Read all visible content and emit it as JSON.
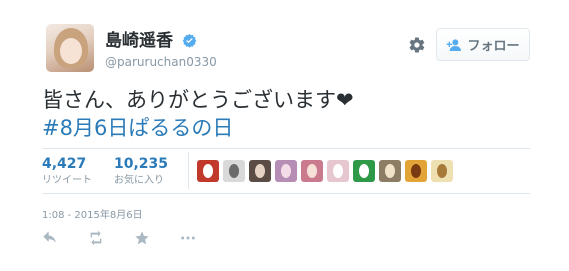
{
  "user": {
    "display_name": "島崎遥香",
    "handle": "@paruruchan0330",
    "verified": true
  },
  "follow_button": {
    "label": "フォロー"
  },
  "tweet": {
    "line1": "皆さん、ありがとうございます",
    "line1_emoji": "❤",
    "line2": "#8月6日ぱるるの日"
  },
  "stats": {
    "retweets": {
      "count": "4,427",
      "label": "リツイート"
    },
    "favorites": {
      "count": "10,235",
      "label": "お気に入り"
    }
  },
  "favoriters_avatars": [
    {
      "name": "avatar-1",
      "color": "#c0392b",
      "accent": "#ffffff"
    },
    {
      "name": "avatar-2",
      "color": "#d9d9d9",
      "accent": "#6b6b6b"
    },
    {
      "name": "avatar-3",
      "color": "#5b4c46",
      "accent": "#e6d3c4"
    },
    {
      "name": "avatar-4",
      "color": "#b68db4",
      "accent": "#f3dbe8"
    },
    {
      "name": "avatar-5",
      "color": "#c97b8d",
      "accent": "#f7e0d8"
    },
    {
      "name": "avatar-6",
      "color": "#e7c7cf",
      "accent": "#ffffff"
    },
    {
      "name": "avatar-7",
      "color": "#2e9a48",
      "accent": "#ffffff"
    },
    {
      "name": "avatar-8",
      "color": "#8c7d64",
      "accent": "#f0e3c8"
    },
    {
      "name": "avatar-9",
      "color": "#e3a437",
      "accent": "#7a3a12"
    },
    {
      "name": "avatar-10",
      "color": "#efe0b2",
      "accent": "#a77a3a"
    }
  ],
  "timestamp": "1:08 - 2015年8月6日",
  "colors": {
    "link": "#2b7bb9",
    "secondary_text": "#8899a6",
    "verified_badge": "#55acee"
  },
  "icons": {
    "reply": "reply-icon",
    "retweet": "retweet-icon",
    "favorite": "star-icon",
    "more": "more-icon",
    "settings": "gear-icon",
    "follow": "add-user-icon",
    "verified": "verified-badge-icon"
  }
}
